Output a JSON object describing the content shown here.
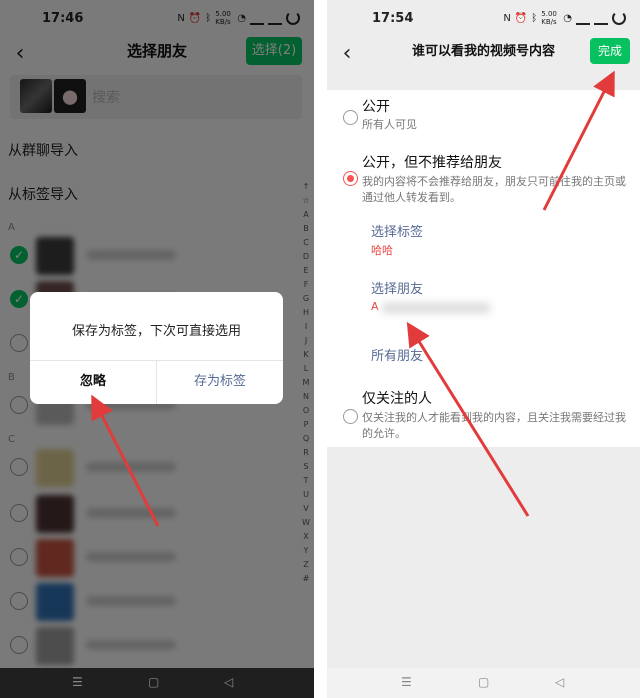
{
  "left": {
    "status_time": "17:46",
    "status_net": "5.00 KB/s",
    "title": "选择朋友",
    "select_button": "选择(2)",
    "search_placeholder": "搜索",
    "import_from_group": "从群聊导入",
    "import_from_tag": "从标签导入",
    "sections": [
      "A",
      "B",
      "C"
    ],
    "alphabet": [
      "↑",
      "☆",
      "A",
      "B",
      "C",
      "D",
      "E",
      "F",
      "G",
      "H",
      "I",
      "J",
      "K",
      "L",
      "M",
      "N",
      "O",
      "P",
      "Q",
      "R",
      "S",
      "T",
      "U",
      "V",
      "W",
      "X",
      "Y",
      "Z",
      "#"
    ],
    "dialog": {
      "message": "保存为标签，下次可直接选用",
      "ignore": "忽略",
      "save_as_tag": "存为标签"
    }
  },
  "right": {
    "status_time": "17:54",
    "status_net": "5.00 KB/s",
    "title": "谁可以看我的视频号内容",
    "done_button": "完成",
    "options": [
      {
        "title": "公开",
        "desc": "所有人可见",
        "selected": false
      },
      {
        "title": "公开，但不推荐给朋友",
        "desc": "我的内容将不会推荐给朋友，朋友只可前往我的主页或通过他人转发看到。",
        "selected": true
      },
      {
        "title": "仅关注的人",
        "desc": "仅关注我的人才能看到我的内容，且关注我需要经过我的允许。",
        "selected": false
      }
    ],
    "select_tag": "选择标签",
    "tag_value": "哈哈",
    "select_friends": "选择朋友",
    "friends_value": "A",
    "all_friends": "所有朋友"
  },
  "colors": {
    "accent_green": "#07c160",
    "link_blue": "#576b95",
    "red": "#fa5151",
    "arrow": "#e23b3b"
  }
}
